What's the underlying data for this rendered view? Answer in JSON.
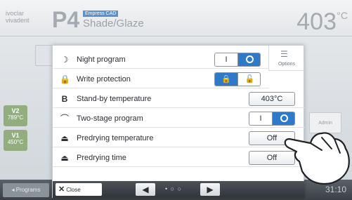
{
  "header": {
    "logo_line1": "ivoclar",
    "logo_line2": "vivadent",
    "program_id": "P4",
    "badge": "Empress CAD",
    "program_name": "Shade/Glaze",
    "temperature": "403",
    "temperature_unit": "°C"
  },
  "background": {
    "side_values": [
      {
        "label": "V2",
        "value": "789°C"
      },
      {
        "label": "V1",
        "value": "450°C"
      }
    ],
    "admin_label": "Admin",
    "programs_label": "Programs",
    "clock": "31:10"
  },
  "dialog": {
    "options_label": "Options",
    "rows": [
      {
        "icon": "night-program-icon",
        "label": "Night program",
        "control": "toggle",
        "left": "I",
        "active": "right"
      },
      {
        "icon": "lock-icon",
        "label": "Write protection",
        "control": "lock-toggle",
        "active": "left"
      },
      {
        "icon": "standby-b-icon",
        "label": "Stand-by temperature",
        "control": "value",
        "value": "403°C"
      },
      {
        "icon": "two-stage-curve-icon",
        "label": "Two-stage program",
        "control": "toggle",
        "left": "I",
        "active": "right"
      },
      {
        "icon": "predrying-icon",
        "label": "Predrying temperature",
        "control": "value",
        "value": "Off"
      },
      {
        "icon": "predrying-icon",
        "label": "Predrying time",
        "control": "value",
        "value": "Off"
      }
    ],
    "footer": {
      "close_label": "Close",
      "pager": "• ○ ○"
    }
  },
  "colors": {
    "accent": "#2e79c8",
    "side_value_green": "#93ad7f"
  }
}
